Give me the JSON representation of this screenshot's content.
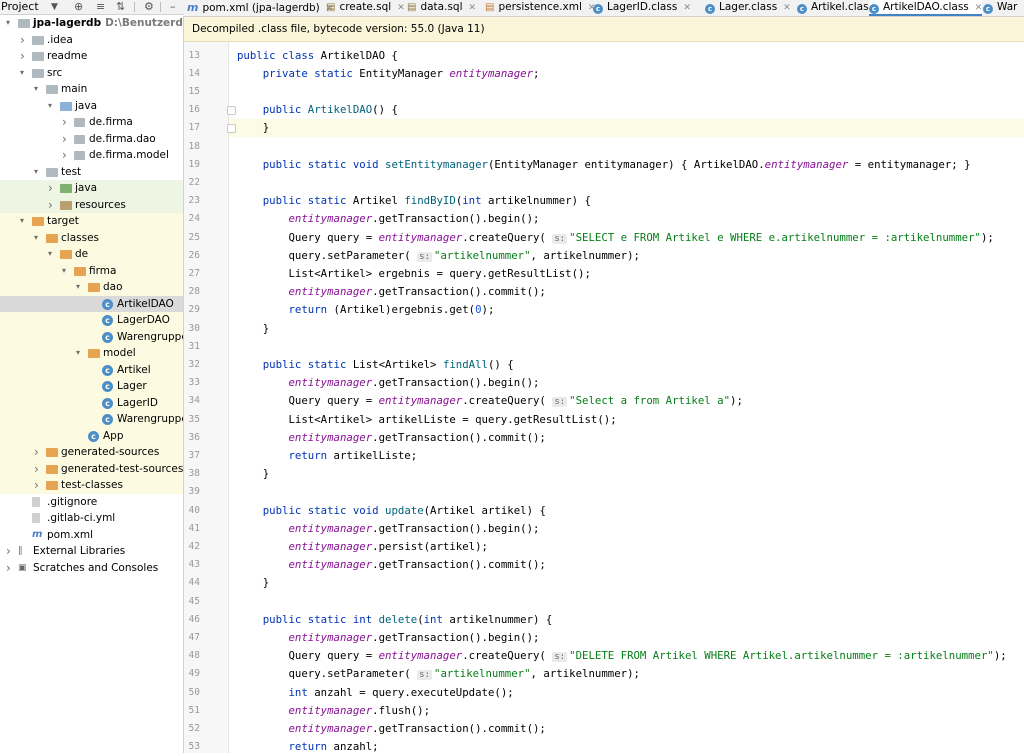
{
  "project_panel": {
    "title": "Project",
    "tree": [
      {
        "label": "jpa-lagerdb",
        "path": "D:\\Benutzerdaten\\Merte",
        "indent": 0,
        "expanded": true,
        "icon": "folder-icon",
        "bold": true,
        "bg": ""
      },
      {
        "label": ".idea",
        "indent": 1,
        "expanded": false,
        "icon": "folder-icon",
        "bg": ""
      },
      {
        "label": "readme",
        "indent": 1,
        "expanded": false,
        "icon": "folder-icon",
        "bg": ""
      },
      {
        "label": "src",
        "indent": 1,
        "expanded": true,
        "icon": "folder-icon",
        "bg": ""
      },
      {
        "label": "main",
        "indent": 2,
        "expanded": true,
        "icon": "folder-icon",
        "bg": ""
      },
      {
        "label": "java",
        "indent": 3,
        "expanded": true,
        "icon": "source-folder-icon",
        "bg": ""
      },
      {
        "label": "de.firma",
        "indent": 4,
        "expanded": false,
        "icon": "package-icon",
        "bg": ""
      },
      {
        "label": "de.firma.dao",
        "indent": 4,
        "expanded": false,
        "icon": "package-icon",
        "bg": ""
      },
      {
        "label": "de.firma.model",
        "indent": 4,
        "expanded": false,
        "icon": "package-icon",
        "bg": ""
      },
      {
        "label": "test",
        "indent": 2,
        "expanded": true,
        "icon": "folder-icon",
        "bg": ""
      },
      {
        "label": "java",
        "indent": 3,
        "expanded": false,
        "icon": "test-folder-icon",
        "bg": "test"
      },
      {
        "label": "resources",
        "indent": 3,
        "expanded": false,
        "icon": "test-resources-icon",
        "bg": "test"
      },
      {
        "label": "target",
        "indent": 1,
        "expanded": true,
        "icon": "excluded-folder-icon",
        "bg": "excl"
      },
      {
        "label": "classes",
        "indent": 2,
        "expanded": true,
        "icon": "excluded-folder-icon",
        "bg": "excl"
      },
      {
        "label": "de",
        "indent": 3,
        "expanded": true,
        "icon": "excluded-folder-icon",
        "bg": "excl"
      },
      {
        "label": "firma",
        "indent": 4,
        "expanded": true,
        "icon": "excluded-folder-icon",
        "bg": "excl"
      },
      {
        "label": "dao",
        "indent": 5,
        "expanded": true,
        "icon": "excluded-folder-icon",
        "bg": "excl"
      },
      {
        "label": "ArtikelDAO",
        "indent": 6,
        "leaf": true,
        "icon": "class-icon",
        "bg": "sel"
      },
      {
        "label": "LagerDAO",
        "indent": 6,
        "leaf": true,
        "icon": "class-icon",
        "bg": "excl"
      },
      {
        "label": "WarengruppeDA",
        "indent": 6,
        "leaf": true,
        "icon": "class-icon",
        "bg": "excl"
      },
      {
        "label": "model",
        "indent": 5,
        "expanded": true,
        "icon": "excluded-folder-icon",
        "bg": "excl"
      },
      {
        "label": "Artikel",
        "indent": 6,
        "leaf": true,
        "icon": "class-icon",
        "bg": "excl"
      },
      {
        "label": "Lager",
        "indent": 6,
        "leaf": true,
        "icon": "class-icon",
        "bg": "excl"
      },
      {
        "label": "LagerID",
        "indent": 6,
        "leaf": true,
        "icon": "class-icon",
        "bg": "excl"
      },
      {
        "label": "Warengruppe",
        "indent": 6,
        "leaf": true,
        "icon": "class-icon",
        "bg": "excl"
      },
      {
        "label": "App",
        "indent": 5,
        "leaf": true,
        "icon": "class-icon",
        "bg": "excl"
      },
      {
        "label": "generated-sources",
        "indent": 2,
        "expanded": false,
        "icon": "excluded-folder-icon",
        "bg": "excl"
      },
      {
        "label": "generated-test-sources",
        "indent": 2,
        "expanded": false,
        "icon": "excluded-folder-icon",
        "bg": "excl"
      },
      {
        "label": "test-classes",
        "indent": 2,
        "expanded": false,
        "icon": "excluded-folder-icon",
        "bg": "excl"
      },
      {
        "label": ".gitignore",
        "indent": 1,
        "leaf": true,
        "icon": "file-icon",
        "bg": ""
      },
      {
        "label": ".gitlab-ci.yml",
        "indent": 1,
        "leaf": true,
        "icon": "yaml-file-icon",
        "bg": ""
      },
      {
        "label": "pom.xml",
        "indent": 1,
        "leaf": true,
        "icon": "maven-icon",
        "bg": ""
      },
      {
        "label": "External Libraries",
        "indent": 0,
        "expanded": false,
        "icon": "library-icon",
        "bg": ""
      },
      {
        "label": "Scratches and Consoles",
        "indent": 0,
        "expanded": false,
        "icon": "scratches-icon",
        "bg": ""
      }
    ]
  },
  "tabs": [
    {
      "label": "pom.xml (jpa-lagerdb)",
      "icon": "maven-icon",
      "active": false
    },
    {
      "label": "create.sql",
      "icon": "sql-file-icon",
      "active": false
    },
    {
      "label": "data.sql",
      "icon": "sql-file-icon",
      "active": false
    },
    {
      "label": "persistence.xml",
      "icon": "xml-file-icon",
      "active": false
    },
    {
      "label": "LagerID.class",
      "icon": "class-icon",
      "active": false
    },
    {
      "label": "Lager.class",
      "icon": "class-icon",
      "active": false
    },
    {
      "label": "Artikel.class",
      "icon": "class-icon",
      "active": false
    },
    {
      "label": "ArtikelDAO.class",
      "icon": "class-icon",
      "active": true
    },
    {
      "label": "War",
      "icon": "class-icon",
      "active": false
    }
  ],
  "banner": {
    "text": "Decompiled .class file, bytecode version: 55.0 (Java 11)"
  },
  "colors": {
    "keyword": "#0033b3",
    "field": "#871094",
    "string": "#067d17",
    "number": "#1750eb",
    "method": "#00627a",
    "caret_line": "#fcfbe3"
  },
  "code": [
    {
      "n": 13,
      "t": [
        [
          "kw",
          "public class "
        ],
        [
          "",
          "ArtikelDAO {"
        ]
      ]
    },
    {
      "n": 14,
      "t": [
        [
          "",
          "    "
        ],
        [
          "kw",
          "private static "
        ],
        [
          "",
          "EntityManager "
        ],
        [
          "fld",
          "entitymanager"
        ],
        [
          "",
          ";"
        ]
      ]
    },
    {
      "n": 15,
      "t": []
    },
    {
      "n": 16,
      "t": [
        [
          "",
          "    "
        ],
        [
          "kw",
          "public "
        ],
        [
          "mth",
          "ArtikelDAO"
        ],
        [
          "",
          "() {"
        ]
      ],
      "fold": true
    },
    {
      "n": 17,
      "t": [
        [
          "",
          "    }"
        ]
      ],
      "fold": true,
      "caret": true
    },
    {
      "n": 18,
      "t": []
    },
    {
      "n": 19,
      "t": [
        [
          "",
          "    "
        ],
        [
          "kw",
          "public static void "
        ],
        [
          "mth",
          "setEntitymanager"
        ],
        [
          "",
          "(EntityManager entitymanager) "
        ],
        [
          "",
          "{ ArtikelDAO."
        ],
        [
          "fld",
          "entitymanager"
        ],
        [
          "",
          " = entitymanager; }"
        ]
      ]
    },
    {
      "n": 22,
      "t": []
    },
    {
      "n": 23,
      "t": [
        [
          "",
          "    "
        ],
        [
          "kw",
          "public static "
        ],
        [
          "",
          "Artikel "
        ],
        [
          "mth",
          "findByID"
        ],
        [
          "",
          "("
        ],
        [
          "kw",
          "int "
        ],
        [
          "",
          "artikelnummer) {"
        ]
      ]
    },
    {
      "n": 24,
      "t": [
        [
          "",
          "        "
        ],
        [
          "fld",
          "entitymanager"
        ],
        [
          "",
          ".getTransaction().begin();"
        ]
      ]
    },
    {
      "n": 25,
      "t": [
        [
          "",
          "        Query query = "
        ],
        [
          "fld",
          "entitymanager"
        ],
        [
          "",
          ".createQuery( "
        ],
        [
          "hint",
          "s:"
        ],
        [
          "str",
          "\"SELECT e FROM Artikel e WHERE e.artikelnummer = :artikelnummer\""
        ],
        [
          "",
          ");"
        ]
      ]
    },
    {
      "n": 26,
      "t": [
        [
          "",
          "        query.setParameter( "
        ],
        [
          "hint",
          "s:"
        ],
        [
          "str",
          "\"artikelnummer\""
        ],
        [
          "",
          ", artikelnummer);"
        ]
      ]
    },
    {
      "n": 27,
      "t": [
        [
          "",
          "        List<Artikel> ergebnis = query.getResultList();"
        ]
      ]
    },
    {
      "n": 28,
      "t": [
        [
          "",
          "        "
        ],
        [
          "fld",
          "entitymanager"
        ],
        [
          "",
          ".getTransaction().commit();"
        ]
      ]
    },
    {
      "n": 29,
      "t": [
        [
          "",
          "        "
        ],
        [
          "kw",
          "return "
        ],
        [
          "",
          "(Artikel)ergebnis.get("
        ],
        [
          "num",
          "0"
        ],
        [
          "",
          ");"
        ]
      ]
    },
    {
      "n": 30,
      "t": [
        [
          "",
          "    }"
        ]
      ]
    },
    {
      "n": 31,
      "t": []
    },
    {
      "n": 32,
      "t": [
        [
          "",
          "    "
        ],
        [
          "kw",
          "public static "
        ],
        [
          "",
          "List<Artikel> "
        ],
        [
          "mth",
          "findAll"
        ],
        [
          "",
          "() {"
        ]
      ]
    },
    {
      "n": 33,
      "t": [
        [
          "",
          "        "
        ],
        [
          "fld",
          "entitymanager"
        ],
        [
          "",
          ".getTransaction().begin();"
        ]
      ]
    },
    {
      "n": 34,
      "t": [
        [
          "",
          "        Query query = "
        ],
        [
          "fld",
          "entitymanager"
        ],
        [
          "",
          ".createQuery( "
        ],
        [
          "hint",
          "s:"
        ],
        [
          "str",
          "\"Select a from Artikel a\""
        ],
        [
          "",
          ");"
        ]
      ]
    },
    {
      "n": 35,
      "t": [
        [
          "",
          "        List<Artikel> artikelListe = query.getResultList();"
        ]
      ]
    },
    {
      "n": 36,
      "t": [
        [
          "",
          "        "
        ],
        [
          "fld",
          "entitymanager"
        ],
        [
          "",
          ".getTransaction().commit();"
        ]
      ]
    },
    {
      "n": 37,
      "t": [
        [
          "",
          "        "
        ],
        [
          "kw",
          "return "
        ],
        [
          "",
          "artikelListe;"
        ]
      ]
    },
    {
      "n": 38,
      "t": [
        [
          "",
          "    }"
        ]
      ]
    },
    {
      "n": 39,
      "t": []
    },
    {
      "n": 40,
      "t": [
        [
          "",
          "    "
        ],
        [
          "kw",
          "public static void "
        ],
        [
          "mth",
          "update"
        ],
        [
          "",
          "(Artikel artikel) {"
        ]
      ]
    },
    {
      "n": 41,
      "t": [
        [
          "",
          "        "
        ],
        [
          "fld",
          "entitymanager"
        ],
        [
          "",
          ".getTransaction().begin();"
        ]
      ]
    },
    {
      "n": 42,
      "t": [
        [
          "",
          "        "
        ],
        [
          "fld",
          "entitymanager"
        ],
        [
          "",
          ".persist(artikel);"
        ]
      ]
    },
    {
      "n": 43,
      "t": [
        [
          "",
          "        "
        ],
        [
          "fld",
          "entitymanager"
        ],
        [
          "",
          ".getTransaction().commit();"
        ]
      ]
    },
    {
      "n": 44,
      "t": [
        [
          "",
          "    }"
        ]
      ]
    },
    {
      "n": 45,
      "t": []
    },
    {
      "n": 46,
      "t": [
        [
          "",
          "    "
        ],
        [
          "kw",
          "public static int "
        ],
        [
          "mth",
          "delete"
        ],
        [
          "",
          "("
        ],
        [
          "kw",
          "int "
        ],
        [
          "",
          "artikelnummer) {"
        ]
      ]
    },
    {
      "n": 47,
      "t": [
        [
          "",
          "        "
        ],
        [
          "fld",
          "entitymanager"
        ],
        [
          "",
          ".getTransaction().begin();"
        ]
      ]
    },
    {
      "n": 48,
      "t": [
        [
          "",
          "        Query query = "
        ],
        [
          "fld",
          "entitymanager"
        ],
        [
          "",
          ".createQuery( "
        ],
        [
          "hint",
          "s:"
        ],
        [
          "str",
          "\"DELETE FROM Artikel WHERE Artikel.artikelnummer = :artikelnummer\""
        ],
        [
          "",
          ");"
        ]
      ]
    },
    {
      "n": 49,
      "t": [
        [
          "",
          "        query.setParameter( "
        ],
        [
          "hint",
          "s:"
        ],
        [
          "str",
          "\"artikelnummer\""
        ],
        [
          "",
          ", artikelnummer);"
        ]
      ]
    },
    {
      "n": 50,
      "t": [
        [
          "",
          "        "
        ],
        [
          "kw",
          "int "
        ],
        [
          "",
          "anzahl = query.executeUpdate();"
        ]
      ]
    },
    {
      "n": 51,
      "t": [
        [
          "",
          "        "
        ],
        [
          "fld",
          "entitymanager"
        ],
        [
          "",
          ".flush();"
        ]
      ]
    },
    {
      "n": 52,
      "t": [
        [
          "",
          "        "
        ],
        [
          "fld",
          "entitymanager"
        ],
        [
          "",
          ".getTransaction().commit();"
        ]
      ]
    },
    {
      "n": 53,
      "t": [
        [
          "",
          "        "
        ],
        [
          "kw",
          "return "
        ],
        [
          "",
          "anzahl;"
        ]
      ]
    }
  ]
}
